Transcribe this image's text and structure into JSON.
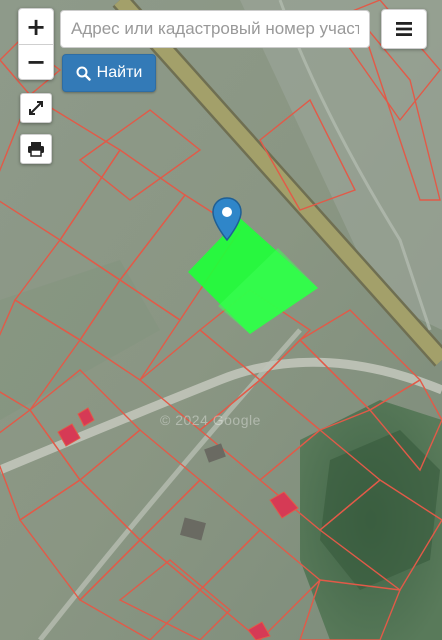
{
  "search": {
    "placeholder": "Адрес или кадастровый номер участка",
    "value": ""
  },
  "toolbar": {
    "find_label": "Найти",
    "zoom_in_label": "+",
    "zoom_out_label": "−"
  },
  "map": {
    "watermark": "© 2024 Google",
    "colors": {
      "parcel_outline": "#e25a48",
      "selected_parcel": "#1fff3a",
      "building": "#d63a55",
      "road": "#a3a06a",
      "pin": "#2f86c9"
    }
  },
  "icons": {
    "zoom_in": "plus-icon",
    "zoom_out": "minus-icon",
    "fullscreen": "expand-icon",
    "print": "printer-icon",
    "menu": "hamburger-icon",
    "search": "search-icon",
    "marker": "location-pin-icon"
  }
}
